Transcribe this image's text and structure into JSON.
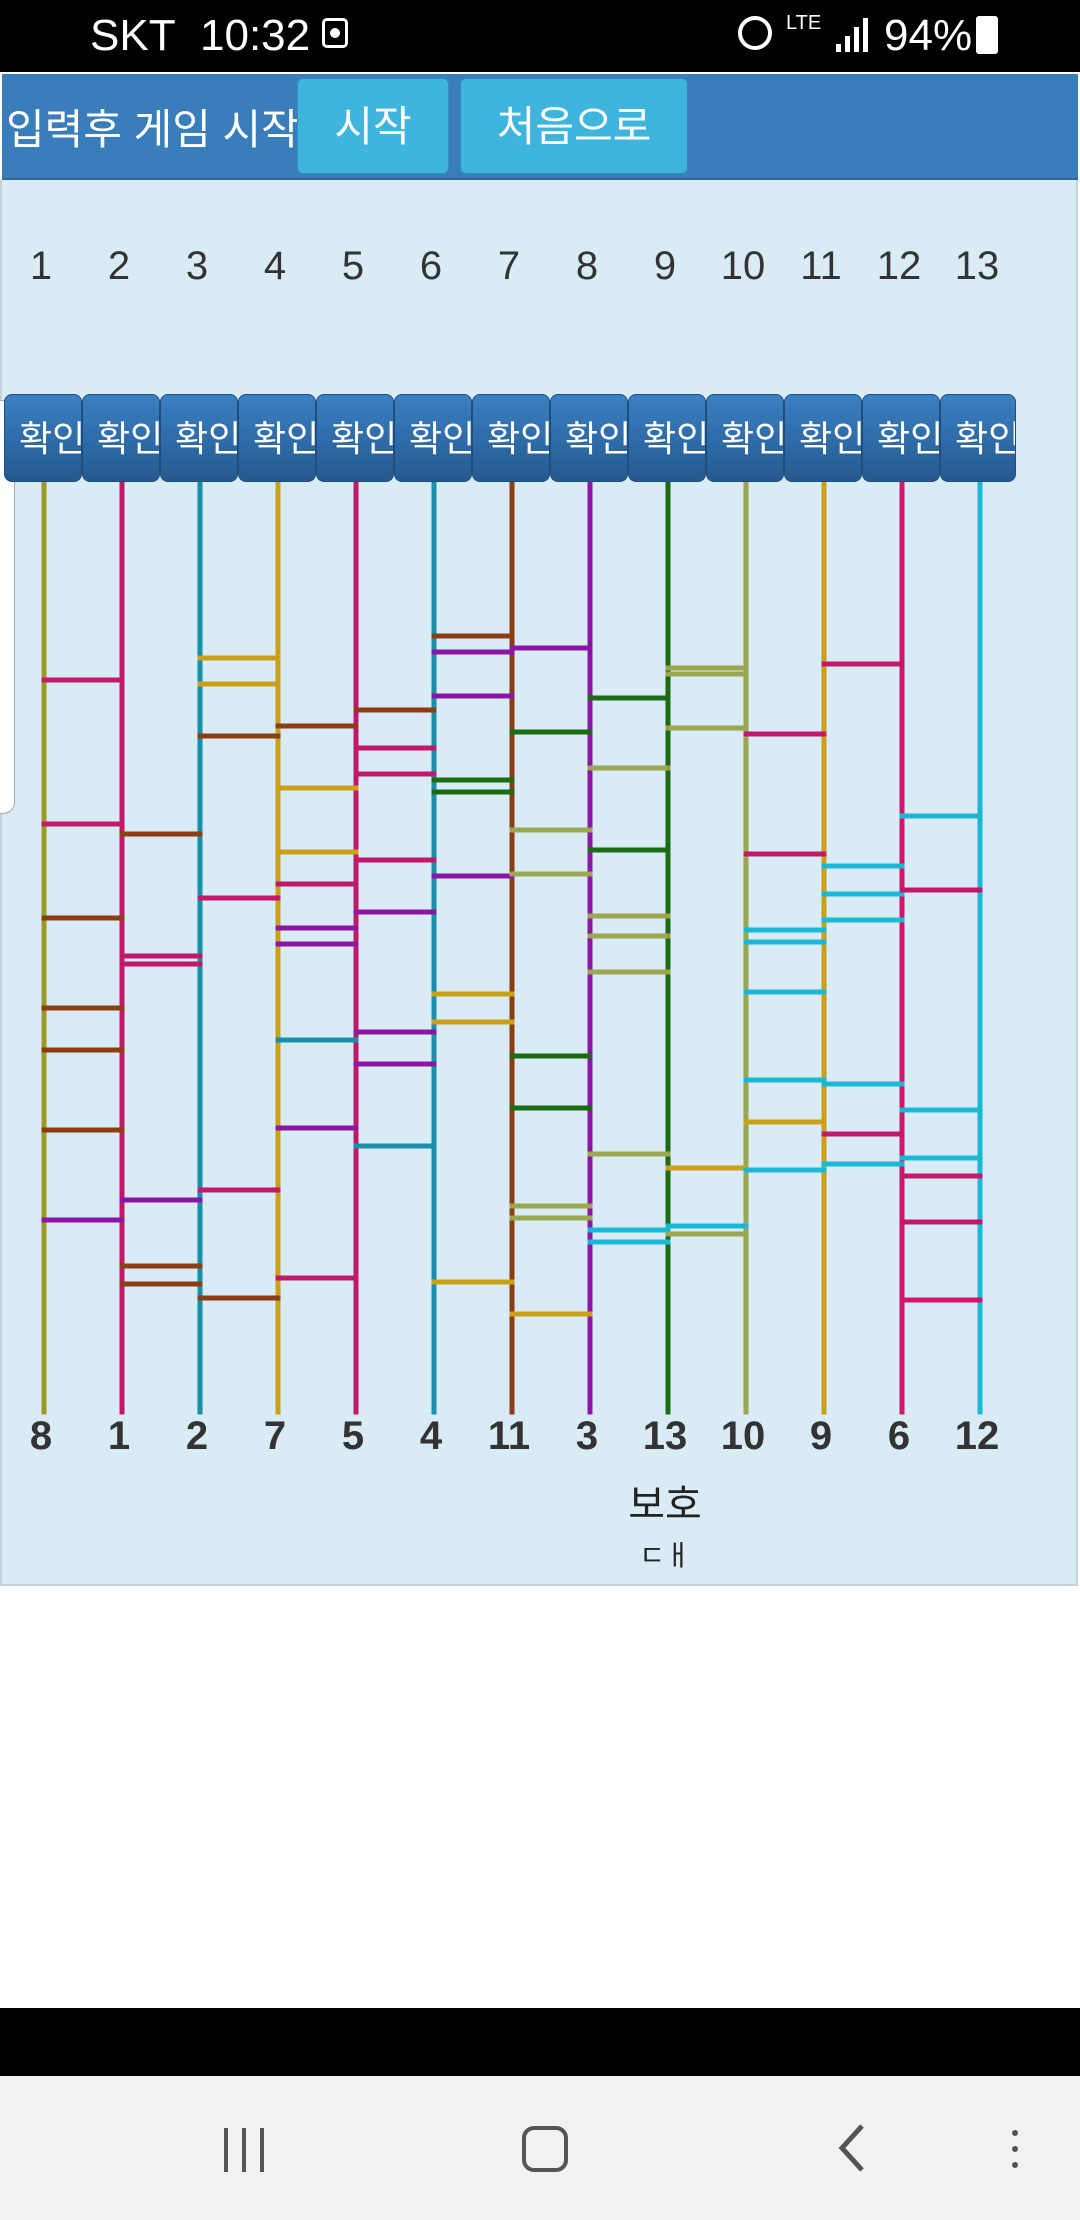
{
  "status_bar": {
    "carrier": "SKT",
    "time": "10:32",
    "network": "LTE",
    "battery": "94%"
  },
  "toolbar": {
    "instruction": "입력후 게임 시작",
    "start_label": "시작",
    "reset_label": "처음으로"
  },
  "check_label": "확인",
  "top_numbers": [
    "1",
    "2",
    "3",
    "4",
    "5",
    "6",
    "7",
    "8",
    "9",
    "10",
    "11",
    "12",
    "13"
  ],
  "bottom_numbers": [
    "8",
    "1",
    "2",
    "7",
    "5",
    "4",
    "11",
    "3",
    "13",
    "10",
    "9",
    "6",
    "12"
  ],
  "extra_labels": [
    "보호",
    "ㄷㅐ"
  ],
  "colors": {
    "purple": "#8b16a6",
    "olive": "#9a9a26",
    "magenta": "#c2186a",
    "teal": "#1a8fab",
    "gold": "#c9a018",
    "brown": "#8b3e14",
    "green": "#1c6a14",
    "lightgreen": "#9aa650",
    "cyan": "#1ab8d6",
    "pink": "#d3156e",
    "toolbar": "#3a7dbb",
    "board": "#d9ebf5"
  }
}
